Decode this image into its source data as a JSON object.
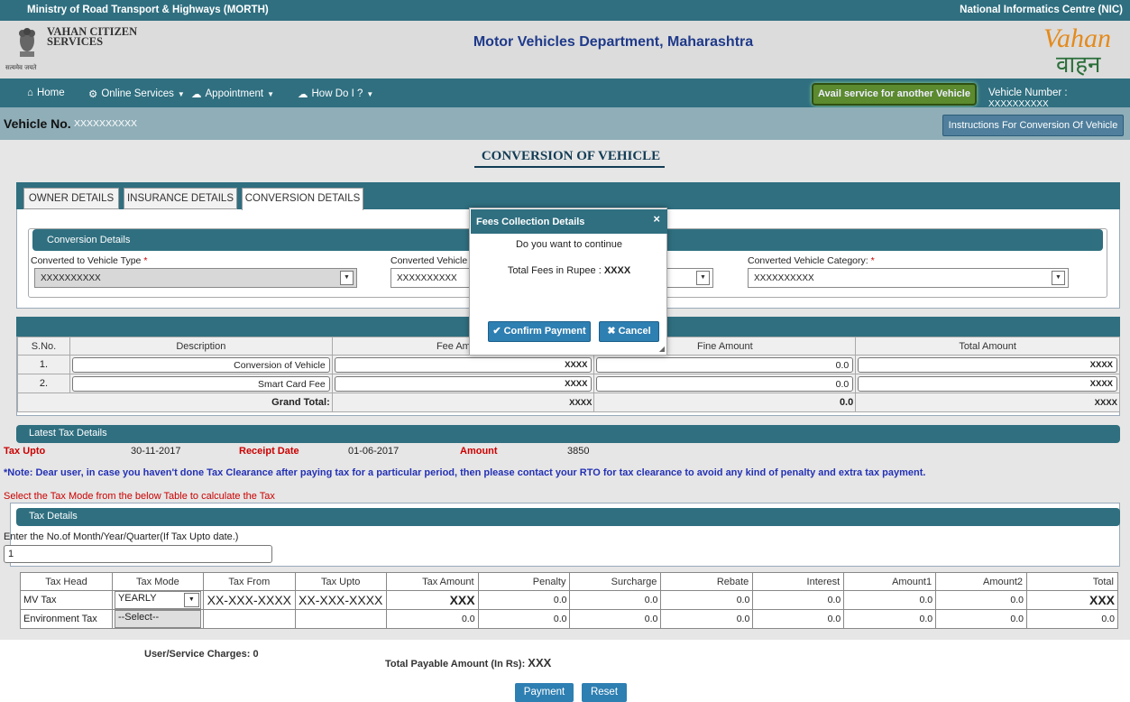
{
  "topbar": {
    "left": "Ministry of Road Transport & Highways (MORTH)",
    "right": "National Informatics Centre (NIC)"
  },
  "header": {
    "emblem_motto": "सत्यमेव जयते",
    "app_name_line1": "VAHAN CITIZEN",
    "app_name_line2": "SERVICES",
    "department": "Motor Vehicles Department, Maharashtra",
    "logo_text_top": "Vahan",
    "logo_text_bottom": "वाहन"
  },
  "nav": {
    "home": "Home",
    "online_services": "Online Services",
    "appointment": "Appointment",
    "how_do_i": "How Do I ?",
    "avail": "Avail service for another Vehicle",
    "vehicle_number_label": "Vehicle Number : ",
    "vehicle_number_value": "XXXXXXXXXX"
  },
  "vehicle_bar": {
    "label": "Vehicle No.",
    "value": "XXXXXXXXXX",
    "instructions_button": "Instructions For Conversion Of Vehicle"
  },
  "page_title": "CONVERSION OF VEHICLE",
  "tabs": [
    "OWNER DETAILS",
    "INSURANCE DETAILS",
    "CONVERSION DETAILS"
  ],
  "conversion": {
    "heading": "Conversion Details",
    "fields": [
      {
        "label": "Converted to Vehicle Type",
        "value": "XXXXXXXXXX"
      },
      {
        "label": "Converted Vehicle",
        "value": "XXXXXXXXXX"
      },
      {
        "label": "Converted Vehicle Category:",
        "value": "XXXXXXXXXX"
      }
    ]
  },
  "fees": {
    "headers": [
      "S.No.",
      "Description",
      "Fee Amount",
      "Fine Amount",
      "Total Amount"
    ],
    "rows": [
      {
        "sno": "1.",
        "desc": "Conversion of Vehicle",
        "fee": "XXXX",
        "fine": "0.0",
        "total": "XXXX"
      },
      {
        "sno": "2.",
        "desc": "Smart Card Fee",
        "fee": "XXXX",
        "fine": "0.0",
        "total": "XXXX"
      }
    ],
    "grand_label": "Grand Total:",
    "grand_fee": "XXXX",
    "grand_fine": "0.0",
    "grand_total": "XXXX"
  },
  "latest_tax": {
    "heading": "Latest Tax Details",
    "tax_upto_label": "Tax Upto",
    "tax_upto": "30-11-2017",
    "receipt_label": "Receipt Date",
    "receipt": "01-06-2017",
    "amount_label": "Amount",
    "amount": "3850",
    "note": "*Note: Dear user, in case you haven't done Tax Clearance after paying tax for a particular period, then please contact your RTO for tax clearance to avoid any kind of penalty and extra tax payment."
  },
  "select_msg": "Select the Tax Mode from the below Table to calculate the Tax",
  "tax_details": {
    "heading": "Tax Details",
    "months_label": "Enter the No.of Month/Year/Quarter(If Tax Upto date.)",
    "months_value": "1",
    "headers": [
      "Tax Head",
      "Tax Mode",
      "Tax From",
      "Tax Upto",
      "Tax Amount",
      "Penalty",
      "Surcharge",
      "Rebate",
      "Interest",
      "Amount1",
      "Amount2",
      "Total"
    ],
    "rows": [
      {
        "head": "MV Tax",
        "mode": "YEARLY",
        "from": "XX-XXX-XXXX",
        "upto": "XX-XXX-XXXX",
        "amount": "XXX",
        "penalty": "0.0",
        "surcharge": "0.0",
        "rebate": "0.0",
        "interest": "0.0",
        "amount1": "0.0",
        "amount2": "0.0",
        "total": "XXX"
      },
      {
        "head": "Environment Tax",
        "mode": "--Select--",
        "from": "",
        "upto": "",
        "amount": "0.0",
        "penalty": "0.0",
        "surcharge": "0.0",
        "rebate": "0.0",
        "interest": "0.0",
        "amount1": "0.0",
        "amount2": "0.0",
        "total": "0.0"
      }
    ]
  },
  "footer": {
    "user_charges_label": "User/Service Charges: ",
    "user_charges": "0",
    "total_label": "Total Payable Amount (In Rs): ",
    "total": "XXX",
    "payment": "Payment",
    "reset": "Reset"
  },
  "modal": {
    "title": "Fees Collection Details",
    "close": "×",
    "message": "Do you want to continue",
    "fees_label": "Total Fees in Rupee : ",
    "fees_value": "XXXX",
    "confirm": "Confirm Payment",
    "cancel": "Cancel"
  },
  "colors": {
    "primary": "#2f6f80",
    "button": "#2e7fb2",
    "avail": "#5c8a2e",
    "title": "#1f3a8a",
    "note": "#2431b5",
    "alert": "#cc0000"
  }
}
